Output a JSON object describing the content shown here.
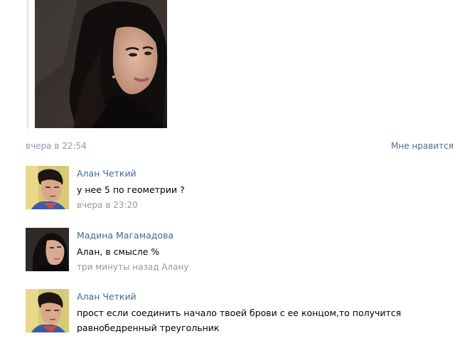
{
  "post": {
    "time": "вчера в 22:54",
    "like_label": "Мне нравится"
  },
  "comments": [
    {
      "author": "Алан Четкий",
      "text": "у нее 5 по геометрии ?",
      "time": "вчера в 23:20"
    },
    {
      "author": "Мадина Магамадова",
      "text": "Алан, в смысле %",
      "time": "три минуты назад Алану"
    },
    {
      "author": "Алан Четкий",
      "text": "прост если соединить начало твоей брови с ее концом,то получится равнобедренный треугольник",
      "time": ""
    }
  ],
  "colors": {
    "link": "#3e6a93",
    "muted": "#8d9bab",
    "divider": "#d9e1ea"
  }
}
